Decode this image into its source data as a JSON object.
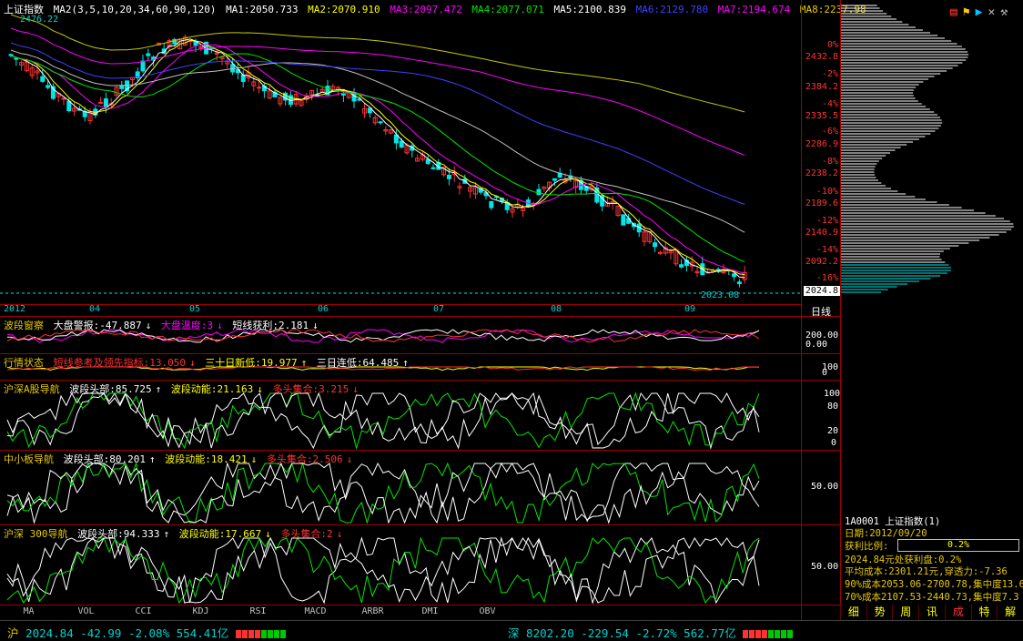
{
  "main": {
    "title": "上证指数",
    "ma_set": "MA2(3,5,10,20,34,60,90,120)",
    "ma1": "MA1:2050.733",
    "ma2": "MA2:2070.910",
    "ma3": "MA3:2097.472",
    "ma4": "MA4:2077.071",
    "ma5": "MA5:2100.839",
    "ma6": "MA6:2129.780",
    "ma7": "MA7:2194.674",
    "ma8": "MA8:2237.98",
    "high_label": "2476.22",
    "low_label": "2023.08",
    "price_ticks": [
      "2432.8",
      "2384.2",
      "2335.5",
      "2286.9",
      "2238.2",
      "2189.6",
      "2140.9",
      "2092.2"
    ],
    "pct_ticks": [
      "0%",
      "-2%",
      "-4%",
      "-6%",
      "-8%",
      "-10%",
      "-12%",
      "-14%",
      "-16%"
    ],
    "current_price": "2024.8",
    "months": [
      "2012",
      "04",
      "05",
      "06",
      "07",
      "08",
      "09"
    ],
    "period": "日线"
  },
  "panel1": {
    "name": "波段窗察",
    "f1": "大盘警报:-47.887",
    "f2": "大盘温度:3",
    "f3": "短线获利:2.181",
    "ticks": [
      "200.00",
      "0.00"
    ]
  },
  "panel2": {
    "name": "行情状态",
    "f1": "短线参考及领先指标:13.050",
    "f2": "三十日新低:19.977",
    "f3": "三日连低:64.485",
    "ticks": [
      "100",
      "0"
    ]
  },
  "panel3": {
    "name": "沪深A股导航",
    "f1": "波段头部:85.725",
    "f2": "波段动能:21.163",
    "f3": "多头集合:3.215",
    "ticks": [
      "100",
      "80",
      "20",
      "0"
    ]
  },
  "panel4": {
    "name": "中小板导航",
    "f1": "波段头部:80.201",
    "f2": "波段动能:18.421",
    "f3": "多头集合:2.506",
    "ticks": [
      "50.00"
    ]
  },
  "panel5": {
    "name": "沪深 300导航",
    "f1": "波段头部:94.333",
    "f2": "波段动能:17.667",
    "f3": "多头集合:2",
    "ticks": [
      "50.00"
    ]
  },
  "tabs": [
    "MA",
    "VOL",
    "CCI",
    "KDJ",
    "RSI",
    "MACD",
    "ARBR",
    "DMI",
    "OBV"
  ],
  "side_tabs": [
    "细",
    "势",
    "周",
    "讯",
    "成",
    "特",
    "解"
  ],
  "info": {
    "code": "1A0001 上证指数(1)",
    "date": "日期:2012/09/20",
    "ratio_label": "获利比例:",
    "ratio_value": "0.2%",
    "profit": "2024.84元处获利盘:0.2%",
    "avg": "平均成本:2301.21元,穿透力:-7.36",
    "c90": "90%成本2053.06-2700.78,集中度13.6",
    "c70": "70%成本2107.53-2440.73,集中度7.3"
  },
  "status": {
    "sh_name": "沪",
    "sh_price": "2024.84",
    "sh_chg": "-42.99",
    "sh_pct": "-2.08%",
    "sh_amt": "554.41亿",
    "sz_name": "深",
    "sz_price": "8202.20",
    "sz_chg": "-229.54",
    "sz_pct": "-2.72%",
    "sz_amt": "562.77亿"
  }
}
